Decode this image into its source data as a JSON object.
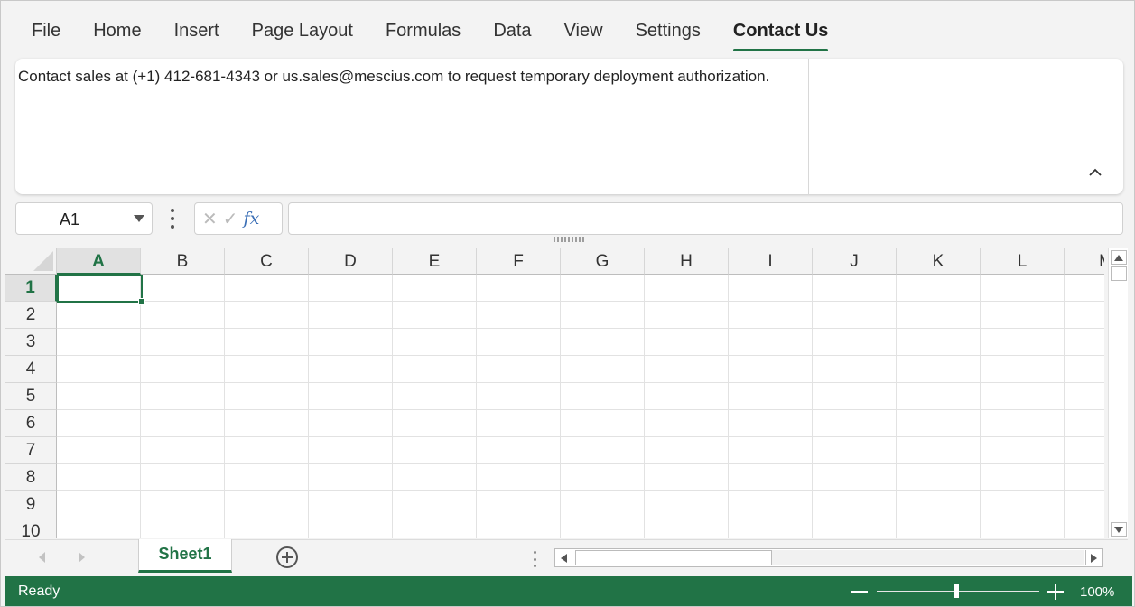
{
  "ribbon": {
    "tabs": [
      {
        "label": "File",
        "active": false
      },
      {
        "label": "Home",
        "active": false
      },
      {
        "label": "Insert",
        "active": false
      },
      {
        "label": "Page Layout",
        "active": false
      },
      {
        "label": "Formulas",
        "active": false
      },
      {
        "label": "Data",
        "active": false
      },
      {
        "label": "View",
        "active": false
      },
      {
        "label": "Settings",
        "active": false
      },
      {
        "label": "Contact Us",
        "active": true
      }
    ],
    "panel_text": "Contact sales at (+1) 412-681-4343 or us.sales@mescius.com to request temporary deployment authorization.",
    "collapse_icon": "chevron-up-icon"
  },
  "formula_bar": {
    "name_box": "A1",
    "formula_value": "",
    "icons": [
      "cancel-icon",
      "confirm-icon",
      "fx-icon"
    ],
    "fx_label": "fx"
  },
  "grid": {
    "columns": [
      "A",
      "B",
      "C",
      "D",
      "E",
      "F",
      "G",
      "H",
      "I",
      "J",
      "K",
      "L",
      "M"
    ],
    "rows": [
      "1",
      "2",
      "3",
      "4",
      "5",
      "6",
      "7",
      "8",
      "9",
      "10"
    ],
    "active_cell": "A1"
  },
  "sheets": {
    "tabs": [
      "Sheet1"
    ],
    "active": "Sheet1"
  },
  "status": {
    "text": "Ready",
    "zoom": "100%",
    "zoom_level": 1.0
  },
  "colors": {
    "accent": "#217346",
    "status_bar": "#217346"
  }
}
